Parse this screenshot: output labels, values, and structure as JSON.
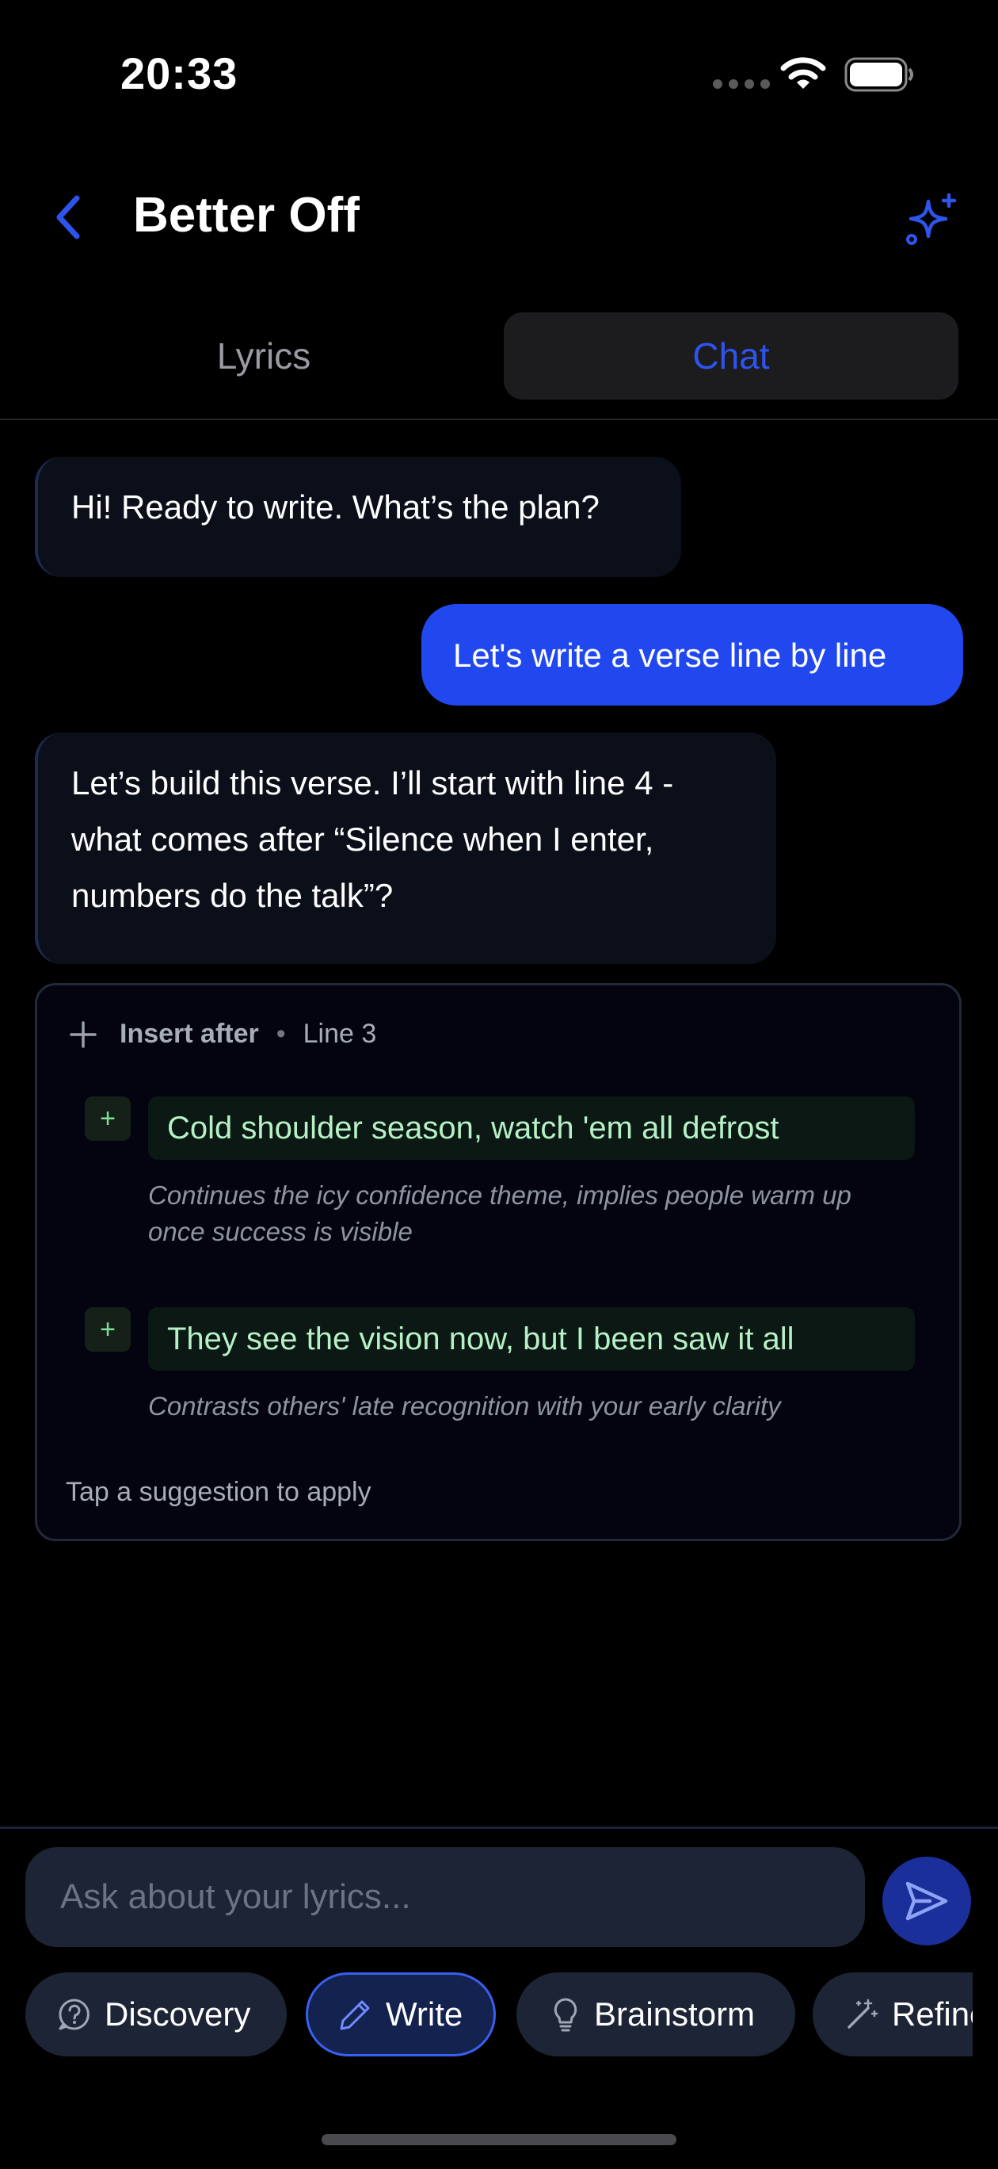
{
  "status_bar": {
    "time": "20:33"
  },
  "header": {
    "title": "Better Off"
  },
  "tabs": [
    {
      "label": "Lyrics",
      "active": false
    },
    {
      "label": "Chat",
      "active": true
    }
  ],
  "messages": [
    {
      "role": "assistant",
      "text": "Hi! Ready to write. What’s the plan?"
    },
    {
      "role": "user",
      "text": "Let's write a verse line by line"
    },
    {
      "role": "assistant",
      "text": "Let’s build this verse. I’ll start with line 4 - what comes after “Silence when I enter, numbers do the talk”?"
    }
  ],
  "suggestions_card": {
    "action": "Insert after",
    "target": "Line 3",
    "items": [
      {
        "line": "Cold shoulder season, watch 'em all defrost",
        "reason": "Continues the icy confidence theme, implies people warm up once success is visible"
      },
      {
        "line": "They see the vision now, but I been saw it all",
        "reason": "Contrasts others' late recognition with your early clarity"
      }
    ],
    "footer": "Tap a suggestion to apply"
  },
  "composer": {
    "placeholder": "Ask about your lyrics..."
  },
  "chips": [
    {
      "label": "Discovery",
      "icon": "question-bubble-icon",
      "active": false
    },
    {
      "label": "Write",
      "icon": "pencil-icon",
      "active": true
    },
    {
      "label": "Brainstorm",
      "icon": "lightbulb-icon",
      "active": false
    },
    {
      "label": "Refine",
      "icon": "magic-wand-icon",
      "active": false
    }
  ],
  "colors": {
    "accent": "#2148ef",
    "background": "#000000",
    "suggestion_text": "#b6f0c6"
  }
}
